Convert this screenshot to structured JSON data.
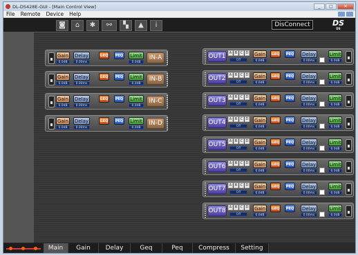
{
  "window": {
    "title": "DL-DS428E-GUI - [Main Control View]",
    "min": "_",
    "max": "□",
    "close": "✕"
  },
  "menu": [
    "File",
    "Remote",
    "Device",
    "Help"
  ],
  "toolbar": {
    "disconnect_label": "DisConnect",
    "logo_text": "DS"
  },
  "labels": {
    "gain": "Gain",
    "delay": "Delay",
    "geq": "GEQ",
    "peq": "PEQ",
    "limit": "Limit",
    "gain_value": "0.0dB",
    "delay_value": "0.00ms",
    "off": "Off",
    "abcd": [
      "A",
      "B",
      "C",
      "D"
    ]
  },
  "inputs": [
    "IN-A",
    "IN-B",
    "IN-C",
    "IN-D"
  ],
  "outputs": [
    "OUT1",
    "OUT2",
    "OUT3",
    "OUT4",
    "OUT5",
    "OUT6",
    "OUT7",
    "OUT8"
  ],
  "tabs": [
    "Main",
    "Gain",
    "Delay",
    "Geq",
    "Peq",
    "Compress",
    "Setting"
  ],
  "active_tab": "Main",
  "colors": {
    "gain": "#c8855a",
    "delay": "#6f8cc0",
    "geq": "#c24810",
    "peq": "#1f4cb8",
    "limit": "#3f9d35",
    "input_label": "#8c6240",
    "output_label": "#4a3e9e"
  }
}
